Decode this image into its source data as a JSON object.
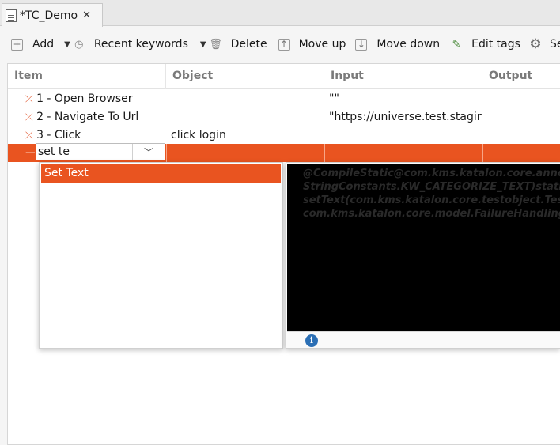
{
  "editor_tab": {
    "title": "*TC_Demo",
    "close_glyph": "✕"
  },
  "toolbar": {
    "add": "Add",
    "recent_keywords": "Recent keywords",
    "delete": "Delete",
    "move_up": "Move up",
    "move_down": "Move down",
    "edit_tags": "Edit tags",
    "settings": "Set"
  },
  "table": {
    "columns": [
      "Item",
      "Object",
      "Input",
      "Output"
    ],
    "rows": [
      {
        "item": "1 - Open Browser",
        "object": "",
        "input": "\"\""
      },
      {
        "item": "2 - Navigate To Url",
        "object": "",
        "input": "\"https://universe.test.staging."
      },
      {
        "item": "3 - Click",
        "object": "click login",
        "input": ""
      }
    ],
    "editing_row": {
      "value": "set te"
    }
  },
  "autocomplete": {
    "options": [
      "Set Text"
    ],
    "doc_lines": [
      "@CompileStatic@com.kms.katalon.core.annota",
      "StringConstants.KW_CATEGORIZE_TEXT)static",
      "setText(com.kms.katalon.core.testobject.TestO",
      "com.kms.katalon.core.model.FailureHandling f)"
    ]
  },
  "icons": {
    "tab": "test-case-icon",
    "add": "add-icon",
    "recent": "history-icon",
    "delete": "trash-icon",
    "move_up": "arrow-up-icon",
    "move_down": "arrow-down-icon",
    "edit_tags": "tag-edit-icon",
    "settings": "gear-icon",
    "row_marker": "failed-step-icon",
    "info": "info-icon"
  },
  "colors": {
    "accent": "#e95420",
    "step_marker": "#e0542a"
  }
}
